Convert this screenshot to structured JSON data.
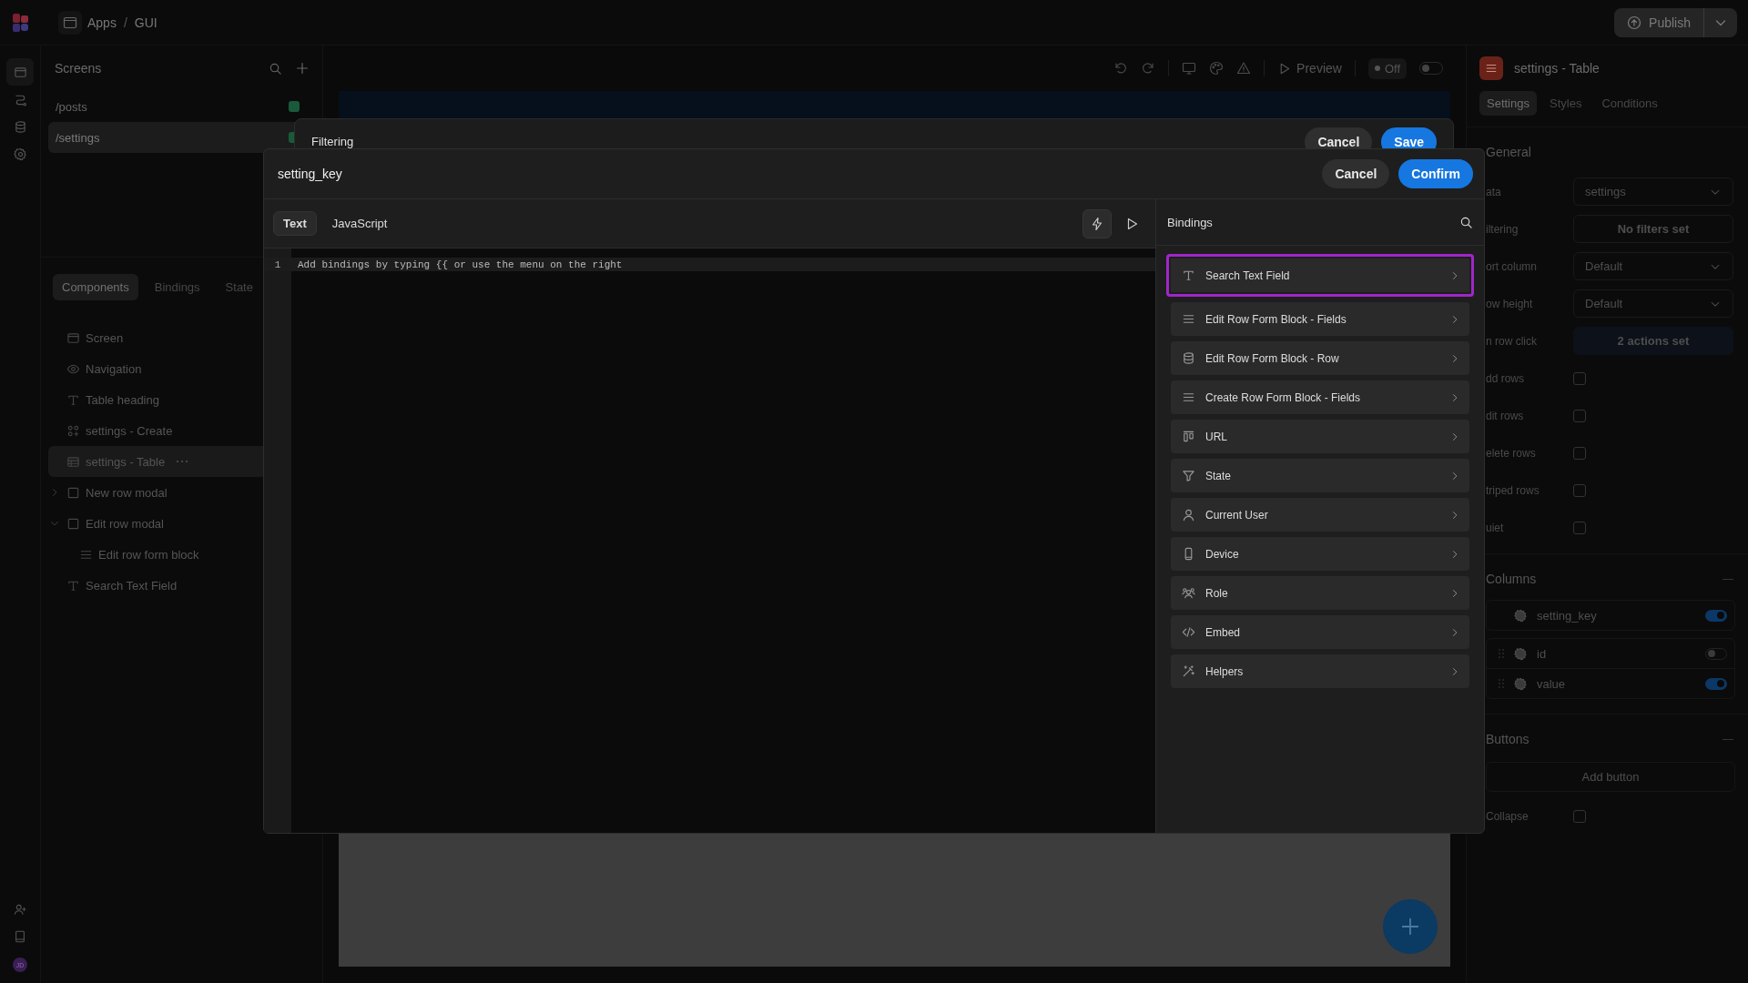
{
  "top_bar": {
    "breadcrumb": [
      {
        "label": "Apps"
      },
      {
        "label": "GUI"
      }
    ],
    "separator": "/",
    "publish": "Publish",
    "user_avatar": "JD"
  },
  "screens": {
    "title": "Screens",
    "items": [
      {
        "path": "/posts",
        "selected": false
      },
      {
        "path": "/settings",
        "selected": true
      }
    ]
  },
  "components": {
    "tabs": [
      {
        "label": "Components",
        "selected": true
      },
      {
        "label": "Bindings",
        "selected": false
      },
      {
        "label": "State",
        "selected": false
      }
    ],
    "tree": [
      {
        "label": "Screen",
        "kind": "screen",
        "selected": false
      },
      {
        "label": "Navigation",
        "kind": "navigation",
        "selected": false
      },
      {
        "label": "Table heading",
        "kind": "text",
        "selected": false
      },
      {
        "label": "settings - Create",
        "kind": "form",
        "selected": false
      },
      {
        "label": "settings - Table",
        "kind": "table",
        "selected": true
      },
      {
        "label": "New row modal",
        "kind": "modal",
        "selected": false,
        "expanded": false
      },
      {
        "label": "Edit row modal",
        "kind": "modal",
        "selected": false,
        "expanded": true,
        "children": [
          {
            "label": "Edit row form block",
            "kind": "list",
            "selected": false
          }
        ]
      },
      {
        "label": "Search Text Field",
        "kind": "text",
        "selected": false
      }
    ]
  },
  "canvas_toolbar": {
    "preview": "Preview",
    "mode": "Off",
    "live": false
  },
  "properties": {
    "title": "settings - Table",
    "tabs": [
      {
        "label": "Settings",
        "selected": true
      },
      {
        "label": "Styles",
        "selected": false
      },
      {
        "label": "Conditions",
        "selected": false
      }
    ],
    "general": {
      "heading": "General",
      "rows": [
        {
          "kind": "select",
          "label": "ata",
          "value": "settings"
        },
        {
          "kind": "button",
          "label": "iltering",
          "value": "No filters set"
        },
        {
          "kind": "select",
          "label": "ort column",
          "value": "Default"
        },
        {
          "kind": "select",
          "label": "ow height",
          "value": "Default"
        },
        {
          "kind": "action",
          "label": "n row click",
          "value": "2 actions set"
        },
        {
          "kind": "checkbox",
          "label": "dd rows",
          "checked": false
        },
        {
          "kind": "checkbox",
          "label": "dit rows",
          "checked": false
        },
        {
          "kind": "checkbox",
          "label": "elete rows",
          "checked": false
        },
        {
          "kind": "checkbox",
          "label": "triped rows",
          "checked": false
        },
        {
          "kind": "checkbox",
          "label": "uiet",
          "checked": false
        }
      ]
    },
    "columns": {
      "heading": "Columns",
      "items": [
        {
          "name": "setting_key",
          "on": true,
          "draggable": false
        },
        {
          "name": "id",
          "on": false,
          "draggable": true
        },
        {
          "name": "value",
          "on": true,
          "draggable": true
        }
      ]
    },
    "buttons": {
      "heading": "Buttons",
      "add": "Add button",
      "rows": [
        {
          "kind": "checkbox",
          "label": "Collapse",
          "checked": false
        }
      ]
    }
  },
  "filtering_dialog": {
    "title": "Filtering",
    "buttons": [
      {
        "label": "Cancel",
        "kind": "secondary"
      },
      {
        "label": "Save",
        "kind": "primary"
      }
    ]
  },
  "binding_dialog": {
    "title": "setting_key",
    "buttons": [
      {
        "label": "Cancel",
        "kind": "secondary"
      },
      {
        "label": "Confirm",
        "kind": "primary"
      }
    ],
    "mode_tabs": [
      {
        "label": "Text",
        "selected": true
      },
      {
        "label": "JavaScript",
        "selected": false
      }
    ],
    "editor": {
      "lines": [
        {
          "number": "1",
          "text": "Add bindings by typing {{ or use the menu on the right",
          "current": true
        }
      ]
    },
    "bindings": {
      "title": "Bindings",
      "items": [
        {
          "label": "Search Text Field",
          "kind": "text",
          "highlighted": true
        },
        {
          "label": "Edit Row Form Block - Fields",
          "kind": "list",
          "highlighted": false
        },
        {
          "label": "Edit Row Form Block - Row",
          "kind": "database",
          "highlighted": false
        },
        {
          "label": "Create Row Form Block - Fields",
          "kind": "list",
          "highlighted": false
        },
        {
          "label": "URL",
          "kind": "url",
          "highlighted": false
        },
        {
          "label": "State",
          "kind": "filter",
          "highlighted": false
        },
        {
          "label": "Current User",
          "kind": "user",
          "highlighted": false
        },
        {
          "label": "Device",
          "kind": "device",
          "highlighted": false
        },
        {
          "label": "Role",
          "kind": "role",
          "highlighted": false
        },
        {
          "label": "Embed",
          "kind": "code",
          "highlighted": false
        },
        {
          "label": "Helpers",
          "kind": "magic",
          "highlighted": false
        }
      ]
    }
  }
}
